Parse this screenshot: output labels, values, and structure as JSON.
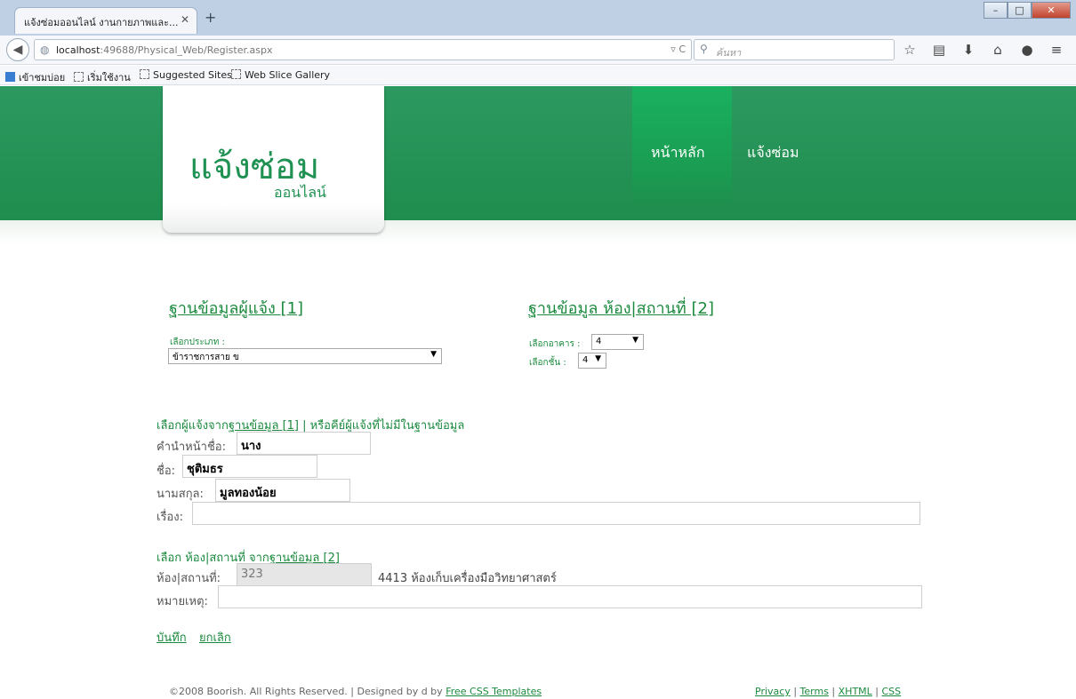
{
  "browser": {
    "tab_title": "แจ้งซ่อมออนไลน์ งานกายภาพและ...",
    "url_host": "localhost",
    "url_rest": ":49688/Physical_Web/Register.aspx",
    "search_placeholder": "ค้นหา",
    "bookmarks": [
      "เข้าชมบ่อย",
      "เริ่มใช้งาน",
      "Suggested Sites",
      "Web Slice Gallery"
    ]
  },
  "header": {
    "logo_title": "แจ้งซ่อม",
    "logo_subtitle": "ออนไลน์",
    "menu": [
      "หน้าหลัก",
      "แจ้งซ่อม"
    ]
  },
  "reporter_db": {
    "title": "ฐานข้อมูลผู้แจ้ง [1]",
    "type_label": "เลือกประเภท :",
    "type_value": "ข้าราชการสาย ข"
  },
  "room_db": {
    "title": "ฐานข้อมูล ห้อง|สถานที่ [2]",
    "building_label": "เลือกอาคาร :",
    "building_value": "4",
    "floor_label": "เลือกชั้น :",
    "floor_value": "4"
  },
  "reporter_form": {
    "heading_prefix": "เลือกผู้แจ้งจาก",
    "heading_link": "ฐานข้อมูล [1]",
    "heading_suffix": " | หรือคีย์ผู้แจ้งที่ไม่มีในฐานข้อมูล",
    "prefix_label": "คำนำหน้าชื่อ:",
    "prefix_value": "นาง",
    "name_label": "ชื่อ:",
    "name_value": "ชุติมธร",
    "surname_label": "นามสกุล:",
    "surname_value": "มูลทองน้อย",
    "subject_label": "เรื่อง:",
    "subject_value": ""
  },
  "room_form": {
    "heading_prefix": "เลือก ห้อง|สถานที่ จาก",
    "heading_link": "ฐานข้อมูล [2]",
    "room_label": "ห้อง|สถานที่:",
    "room_value": "323",
    "room_description": "4413 ห้องเก็บเครื่องมือวิทยาศาสตร์",
    "note_label": "หมายเหตุ:",
    "note_value": ""
  },
  "actions": {
    "save": "บันทึก",
    "cancel": "ยกเลิก"
  },
  "footer": {
    "copyright": "©2008 Boorish. All Rights Reserved. | Designed by d by ",
    "templates_link": "Free CSS Templates",
    "links": [
      "Privacy",
      "Terms",
      "XHTML",
      "CSS"
    ]
  }
}
